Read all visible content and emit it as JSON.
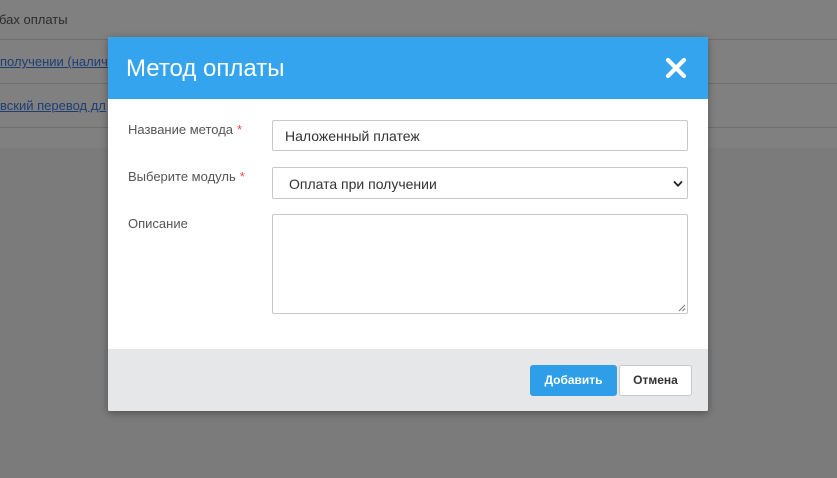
{
  "background": {
    "rows": [
      {
        "text": "бах оплаты",
        "link": false
      },
      {
        "text": "получении (налич",
        "link": true
      },
      {
        "text": "вский перевод дл",
        "link": true
      }
    ]
  },
  "modal": {
    "title": "Метод оплаты",
    "close_icon": "close-icon",
    "fields": {
      "name": {
        "label": "Название метода",
        "required_mark": "*",
        "value": "Наложенный платеж"
      },
      "module": {
        "label": "Выберите модуль",
        "required_mark": "*",
        "selected": "Оплата при получении"
      },
      "description": {
        "label": "Описание",
        "value": ""
      }
    },
    "footer": {
      "add_label": "Добавить",
      "cancel_label": "Отмена"
    }
  },
  "colors": {
    "header": "#35a4ef",
    "primary_button": "#2f9ee9",
    "required": "#e84c4c",
    "overlay": "#808080"
  }
}
